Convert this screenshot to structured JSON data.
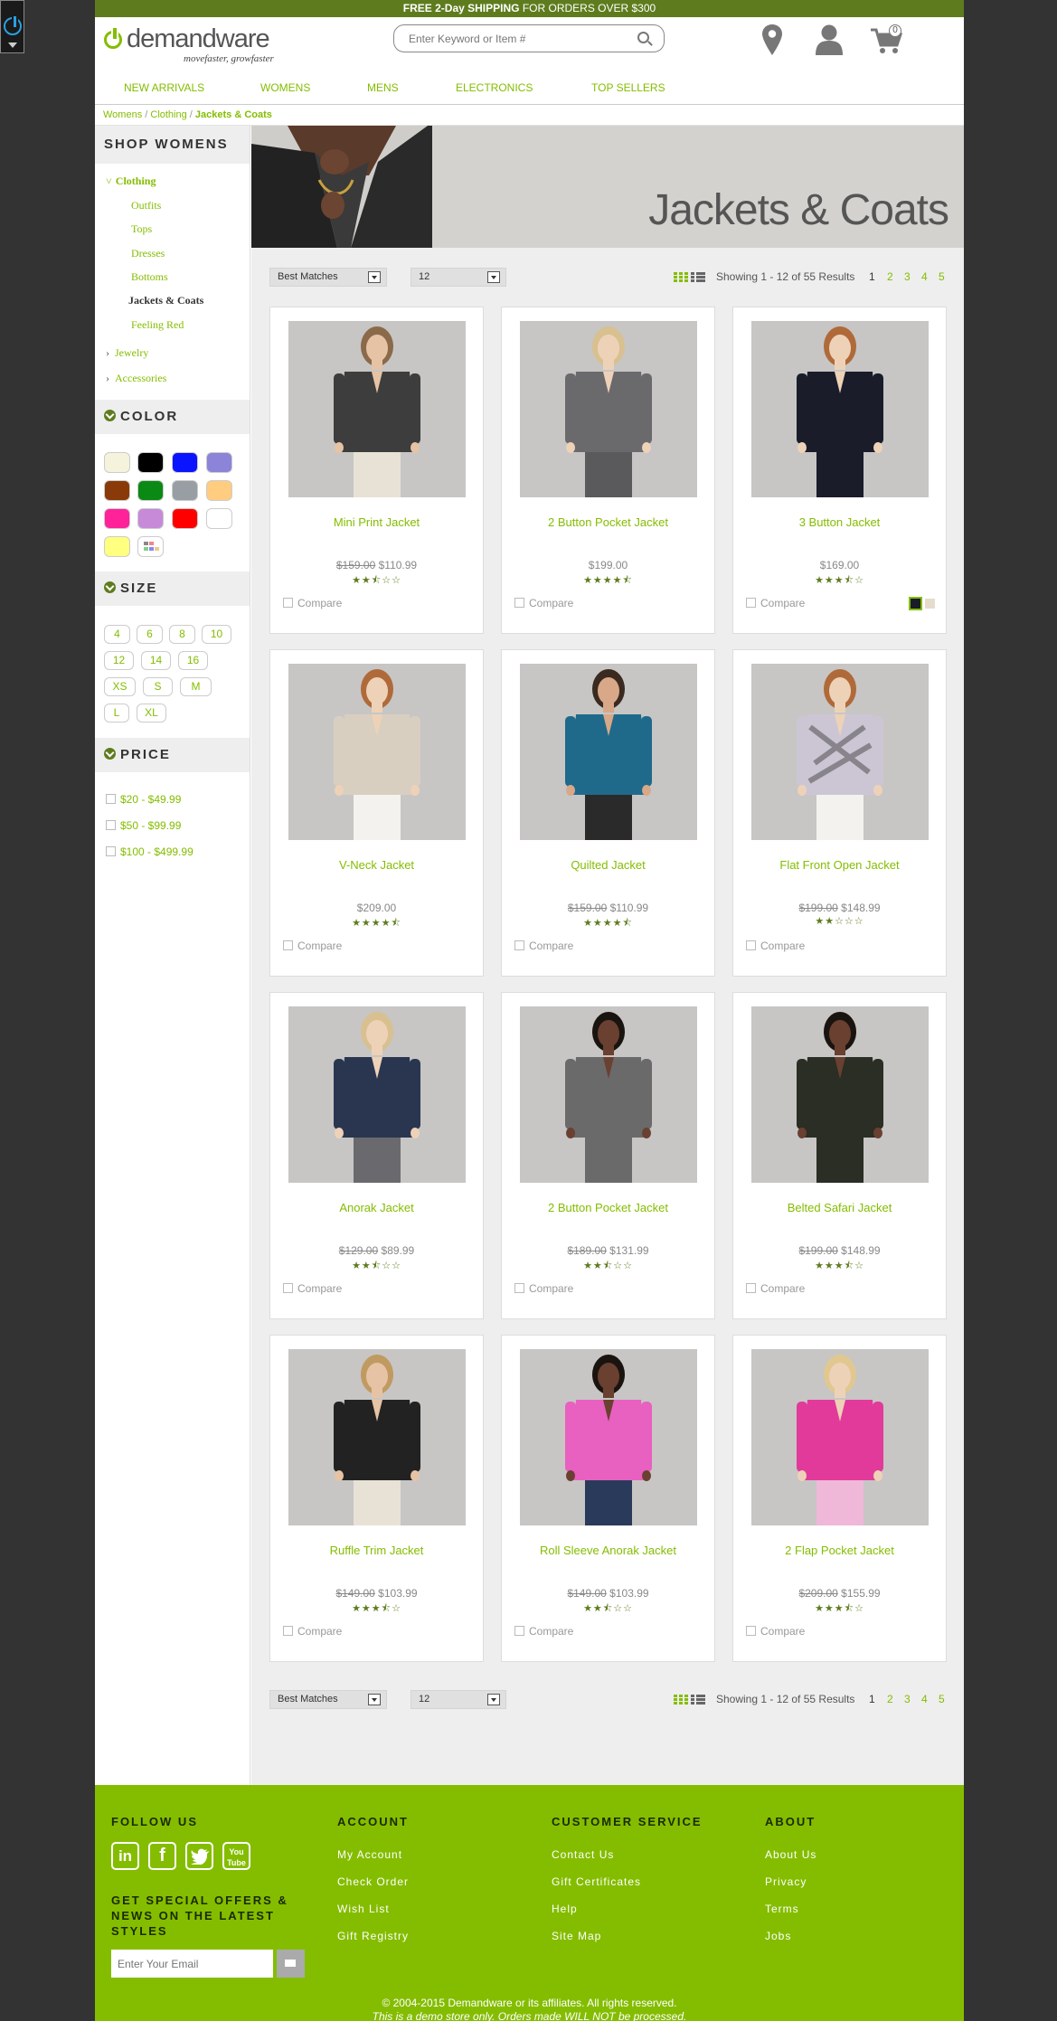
{
  "promo": {
    "bold": "FREE 2-Day SHIPPING",
    "rest": " FOR ORDERS OVER $300"
  },
  "logo": {
    "word": "demandware",
    "tagline": "movefaster, growfaster"
  },
  "search": {
    "placeholder": "Enter Keyword or Item #"
  },
  "header": {
    "cart_count": "0"
  },
  "nav": [
    "NEW ARRIVALS",
    "WOMENS",
    "MENS",
    "ELECTRONICS",
    "TOP SELLERS"
  ],
  "breadcrumb": [
    "Womens",
    "Clothing",
    "Jackets & Coats"
  ],
  "sidebar": {
    "title": "SHOP WOMENS",
    "categories": {
      "clothing": "Clothing",
      "sub": [
        "Outfits",
        "Tops",
        "Dresses",
        "Bottoms",
        "Jackets & Coats",
        "Feeling Red"
      ],
      "jewelry": "Jewelry",
      "accessories": "Accessories"
    },
    "color_title": "COLOR",
    "size_title": "SIZE",
    "sizes": [
      "4",
      "6",
      "8",
      "10",
      "12",
      "14",
      "16",
      "XS",
      "S",
      "M",
      "L",
      "XL"
    ],
    "price_title": "PRICE",
    "prices": [
      "$20 - $49.99",
      "$50 - $99.99",
      "$100 - $499.99"
    ]
  },
  "colors": {
    "swatches": [
      "#f5f3dc",
      "#000000",
      "#0a14ff",
      "#8b84d8",
      "#8a3a08",
      "#0a8a14",
      "#999ea4",
      "#ffcc80",
      "#ff2299",
      "#c68ad8",
      "#ff0000",
      "#ffffff",
      "#ffff80",
      "multi"
    ],
    "accent": "#84bd00",
    "dark_green": "#5e7c1e"
  },
  "banner": {
    "title": "Jackets & Coats"
  },
  "toolbar": {
    "sort": "Best Matches",
    "per_page": "12",
    "showing": "Showing 1 - 12 of 55 Results",
    "pages": [
      "1",
      "2",
      "3",
      "4",
      "5"
    ]
  },
  "products": [
    {
      "name": "Mini Print Jacket",
      "was": "$159.00",
      "now": "$110.99",
      "rating": 2.5
    },
    {
      "name": "2 Button Pocket Jacket",
      "was": "",
      "now": "$199.00",
      "rating": 4.5
    },
    {
      "name": "3 Button Jacket",
      "was": "",
      "now": "$169.00",
      "rating": 3.5
    },
    {
      "name": "V-Neck Jacket",
      "was": "",
      "now": "$209.00",
      "rating": 4.5
    },
    {
      "name": "Quilted Jacket",
      "was": "$159.00",
      "now": "$110.99",
      "rating": 4.5
    },
    {
      "name": "Flat Front Open Jacket",
      "was": "$199.00",
      "now": "$148.99",
      "rating": 2
    },
    {
      "name": "Anorak Jacket",
      "was": "$129.00",
      "now": "$89.99",
      "rating": 2.5
    },
    {
      "name": "2 Button Pocket Jacket",
      "was": "$189.00",
      "now": "$131.99",
      "rating": 2.5
    },
    {
      "name": "Belted Safari Jacket",
      "was": "$199.00",
      "now": "$148.99",
      "rating": 3.5
    },
    {
      "name": "Ruffle Trim Jacket",
      "was": "$149.00",
      "now": "$103.99",
      "rating": 3.5
    },
    {
      "name": "Roll Sleeve Anorak Jacket",
      "was": "$149.00",
      "now": "$103.99",
      "rating": 2.5
    },
    {
      "name": "2 Flap Pocket Jacket",
      "was": "$209.00",
      "now": "$155.99",
      "rating": 3.5
    }
  ],
  "compare_label": "Compare",
  "footer": {
    "follow": "FOLLOW US",
    "offers": "GET SPECIAL OFFERS & NEWS ON THE LATEST STYLES",
    "email_placeholder": "Enter Your Email",
    "account_title": "ACCOUNT",
    "account": [
      "My Account",
      "Check Order",
      "Wish List",
      "Gift Registry"
    ],
    "service_title": "CUSTOMER SERVICE",
    "service": [
      "Contact Us",
      "Gift Certificates",
      "Help",
      "Site Map"
    ],
    "about_title": "ABOUT",
    "about": [
      "About Us",
      "Privacy",
      "Terms",
      "Jobs"
    ],
    "copyright": "© 2004-2015 Demandware or its affiliates. All rights reserved.",
    "demo": "This is a demo store only. Orders made WILL NOT be processed."
  }
}
